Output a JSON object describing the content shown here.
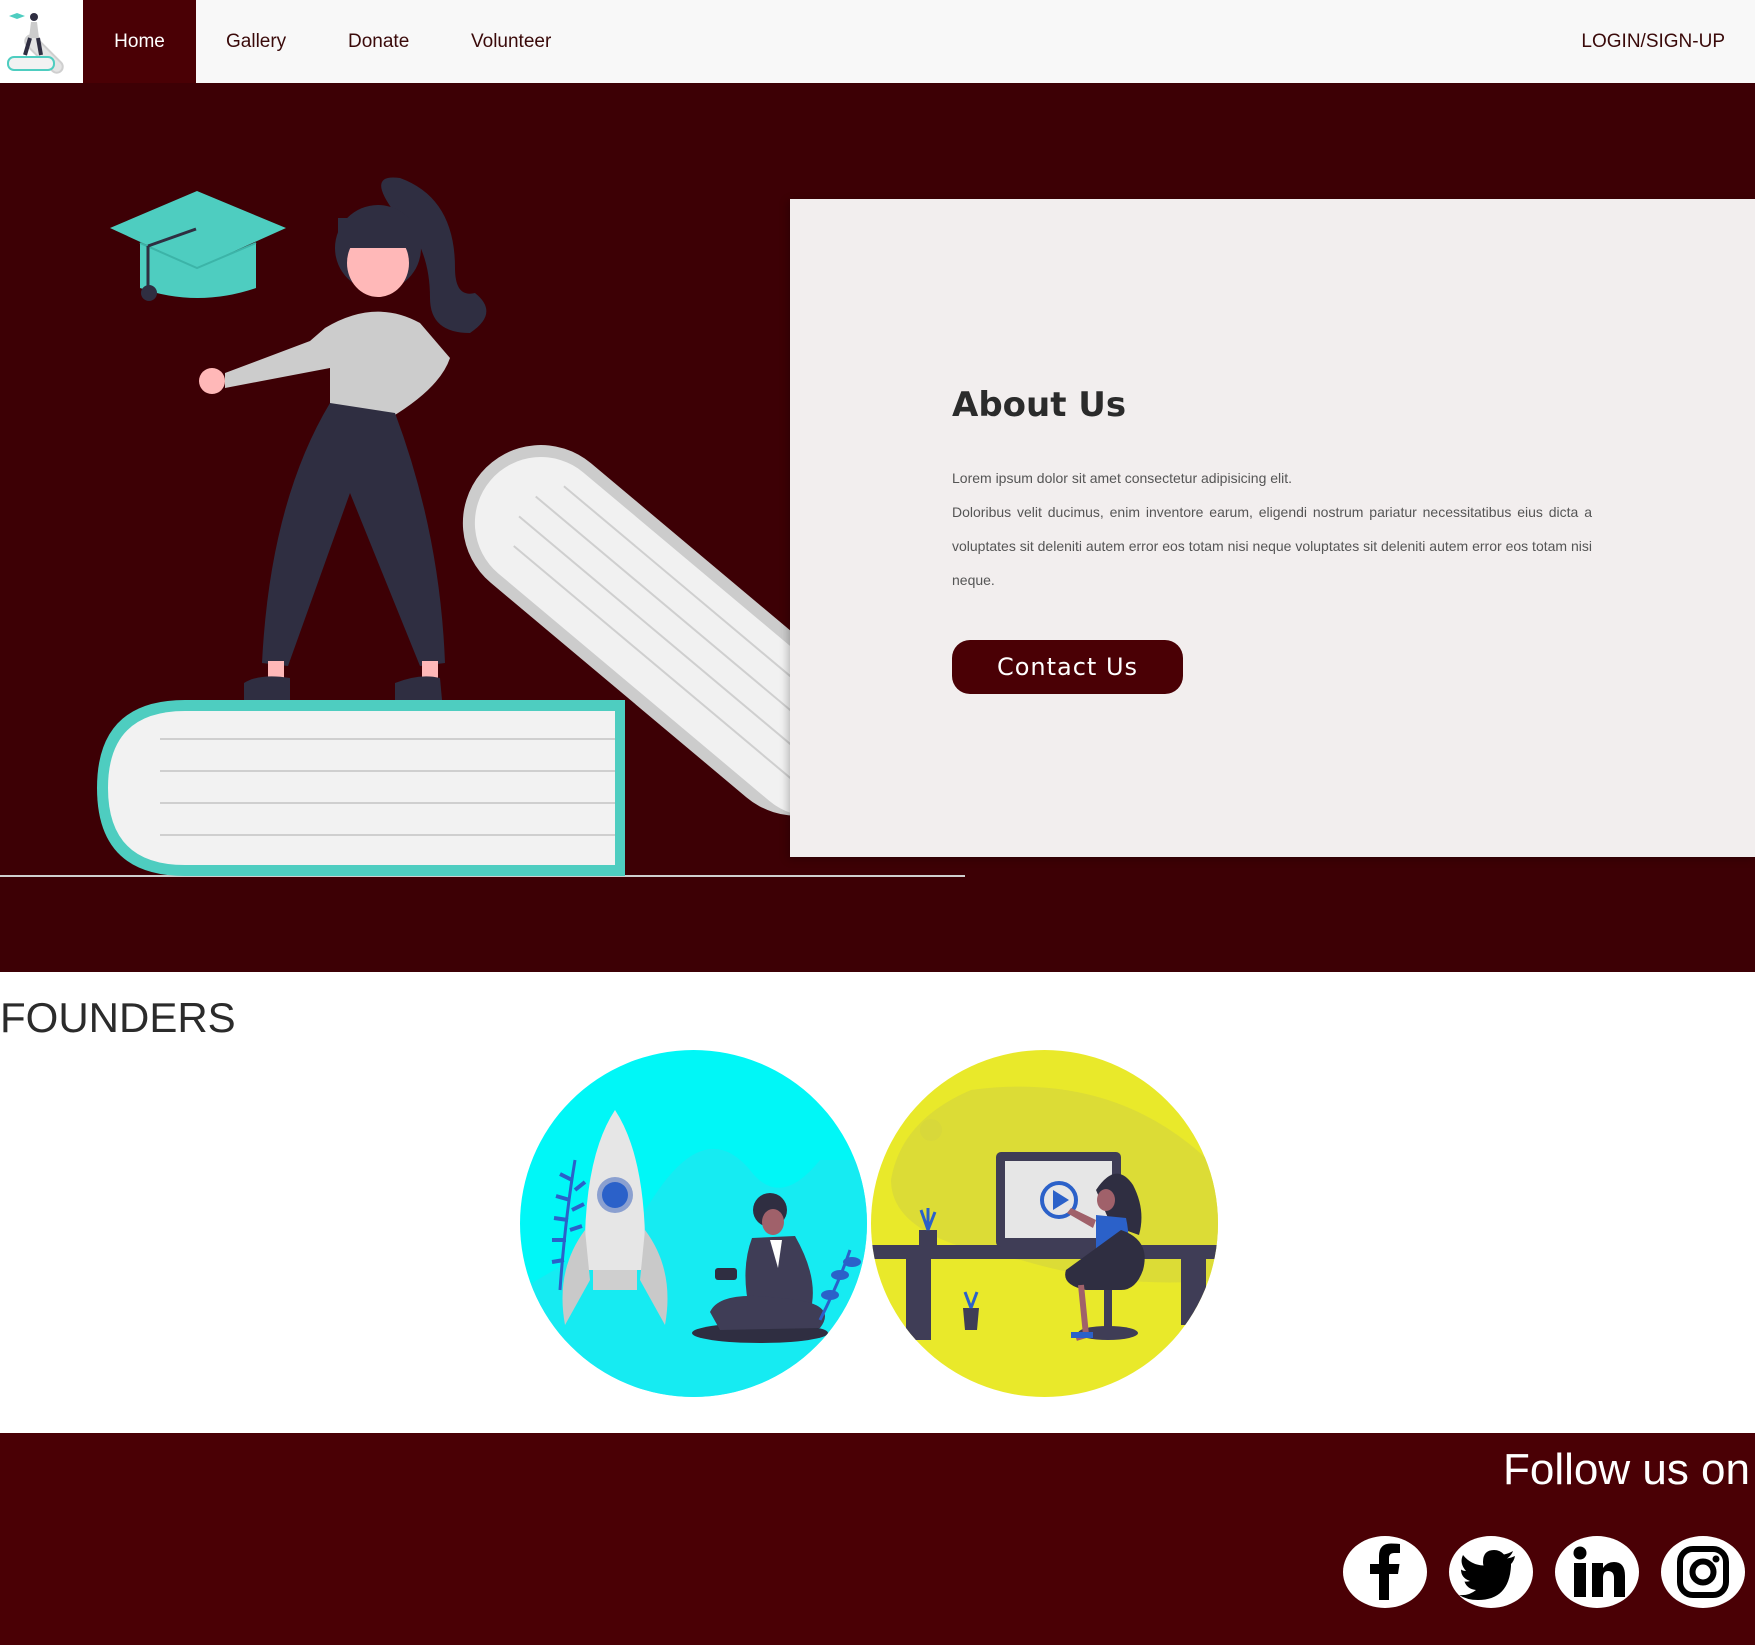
{
  "nav": {
    "logo_icon": "student-on-books-logo-icon",
    "items": [
      {
        "label": "Home",
        "active": true
      },
      {
        "label": "Gallery",
        "active": false
      },
      {
        "label": "Donate",
        "active": false
      },
      {
        "label": "Volunteer",
        "active": false
      }
    ],
    "login_label": "LOGIN/SIGN-UP"
  },
  "hero": {
    "illustration": "graduate-standing-on-books-illustration",
    "about": {
      "title": "About Us",
      "paragraphs": [
        "Lorem ipsum dolor sit amet consectetur adipisicing elit.",
        "Doloribus velit ducimus, enim inventore earum, eligendi nostrum pariatur necessitatibus eius dicta a voluptates sit deleniti autem error eos totam nisi neque voluptates sit deleniti autem error eos totam nisi neque."
      ],
      "button_label": "Contact Us"
    }
  },
  "founders": {
    "title": "FOUNDERS",
    "people": [
      {
        "illustration": "rocket-launch-illustration",
        "background": "#00f7f7"
      },
      {
        "illustration": "video-desk-illustration",
        "background": "#e9e92a"
      }
    ]
  },
  "footer": {
    "follow_text": "Follow us on",
    "social": [
      "facebook-icon",
      "twitter-icon",
      "linkedin-icon",
      "instagram-icon"
    ]
  },
  "colors": {
    "brand_maroon": "#4a0005",
    "hero_background": "#3d0005",
    "card_background": "#f2eeee",
    "teal_accent": "#4ecdc0"
  }
}
